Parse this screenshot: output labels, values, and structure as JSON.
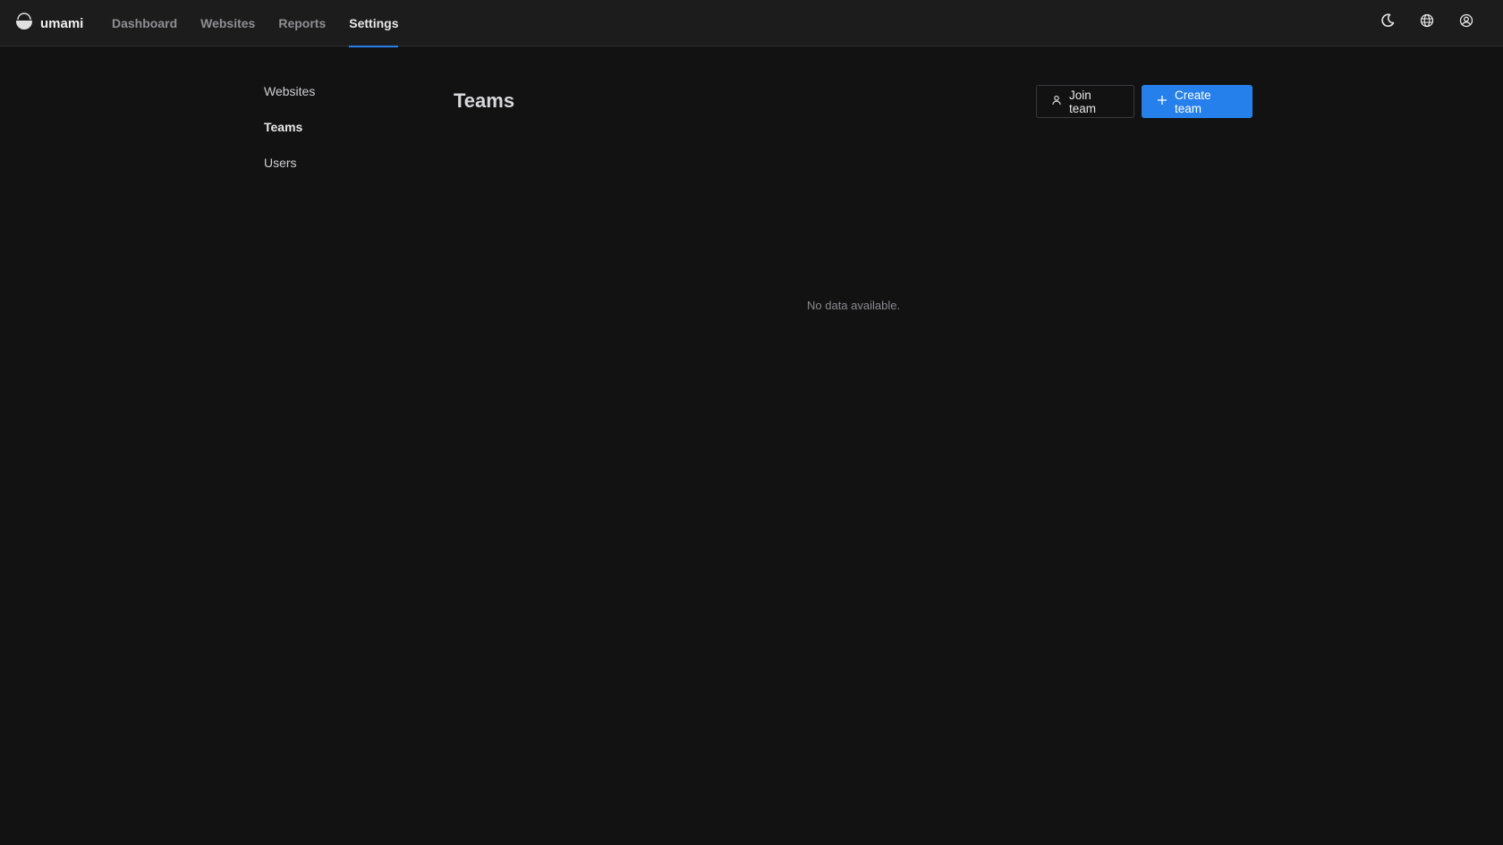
{
  "app": {
    "name": "umami"
  },
  "nav": {
    "items": [
      {
        "label": "Dashboard"
      },
      {
        "label": "Websites"
      },
      {
        "label": "Reports"
      },
      {
        "label": "Settings"
      }
    ],
    "active": "Settings"
  },
  "header_actions": {
    "theme_icon": "moon-icon",
    "language_icon": "globe-icon",
    "profile_icon": "user-circle-icon"
  },
  "sidebar": {
    "items": [
      {
        "label": "Websites"
      },
      {
        "label": "Teams"
      },
      {
        "label": "Users"
      }
    ],
    "active": "Teams"
  },
  "main": {
    "title": "Teams",
    "join_button": {
      "label": "Join team",
      "icon": "user-icon"
    },
    "create_button": {
      "label": "Create team",
      "icon": "plus-icon"
    },
    "empty_message": "No data available."
  },
  "colors": {
    "accent": "#2680eb",
    "background": "#121213",
    "header_background": "#1c1c1d"
  }
}
